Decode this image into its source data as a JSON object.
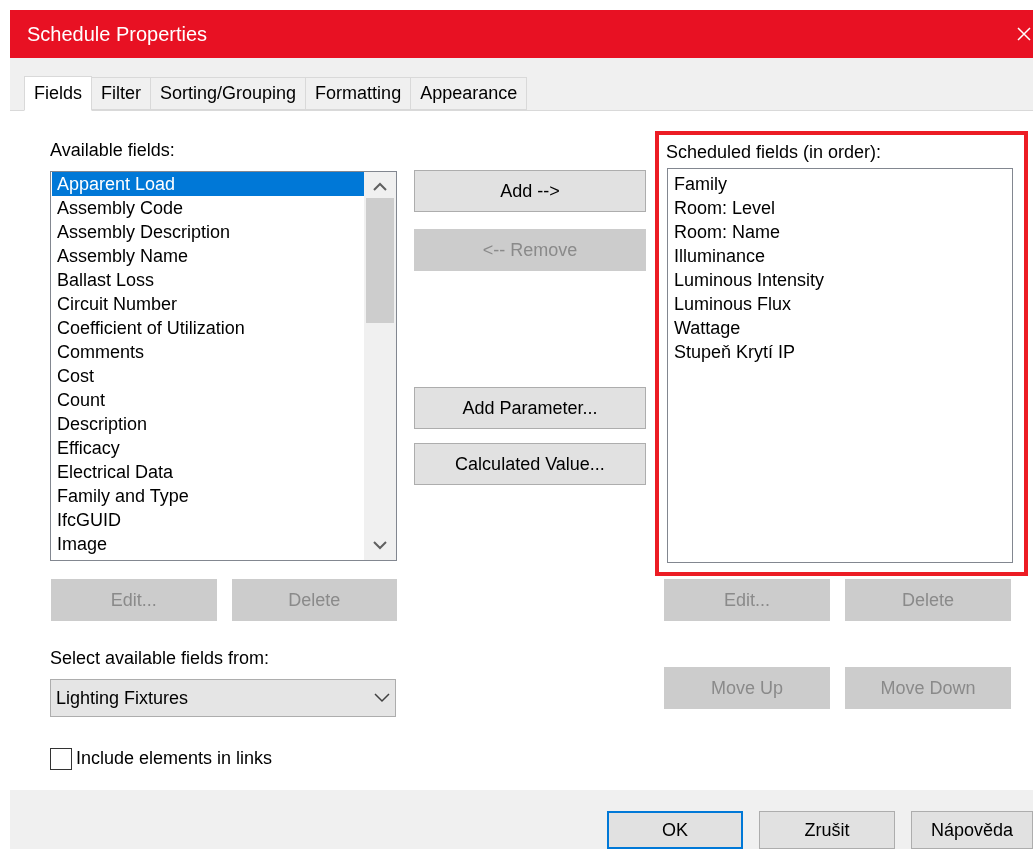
{
  "window": {
    "title": "Schedule Properties"
  },
  "tabs": [
    {
      "label": "Fields",
      "selected": true
    },
    {
      "label": "Filter",
      "selected": false
    },
    {
      "label": "Sorting/Grouping",
      "selected": false
    },
    {
      "label": "Formatting",
      "selected": false
    },
    {
      "label": "Appearance",
      "selected": false
    }
  ],
  "available_fields": {
    "label": "Available fields:",
    "items": [
      {
        "label": "Apparent Load",
        "selected": true
      },
      {
        "label": "Assembly Code",
        "selected": false
      },
      {
        "label": "Assembly Description",
        "selected": false
      },
      {
        "label": "Assembly Name",
        "selected": false
      },
      {
        "label": "Ballast Loss",
        "selected": false
      },
      {
        "label": "Circuit Number",
        "selected": false
      },
      {
        "label": "Coefficient of Utilization",
        "selected": false
      },
      {
        "label": "Comments",
        "selected": false
      },
      {
        "label": "Cost",
        "selected": false
      },
      {
        "label": "Count",
        "selected": false
      },
      {
        "label": "Description",
        "selected": false
      },
      {
        "label": "Efficacy",
        "selected": false
      },
      {
        "label": "Electrical Data",
        "selected": false
      },
      {
        "label": "Family and Type",
        "selected": false
      },
      {
        "label": "IfcGUID",
        "selected": false
      },
      {
        "label": "Image",
        "selected": false
      }
    ],
    "buttons": [
      {
        "label": "Edit...",
        "disabled": true
      },
      {
        "label": "Delete",
        "disabled": true
      }
    ]
  },
  "source": {
    "label": "Select available fields from:",
    "value": "Lighting Fixtures"
  },
  "include_links": {
    "label": "Include elements in links",
    "checked": false
  },
  "middle_buttons": [
    {
      "label": "Add -->",
      "disabled": false,
      "kind": "top"
    },
    {
      "label": "<-- Remove",
      "disabled": true,
      "kind": "top"
    },
    {
      "label": "Add Parameter...",
      "disabled": false,
      "kind": "bottom"
    },
    {
      "label": "Calculated Value...",
      "disabled": false,
      "kind": "bottom"
    }
  ],
  "scheduled_fields": {
    "label": "Scheduled fields (in order):",
    "highlighted": true,
    "items": [
      {
        "label": "Family",
        "selected": false
      },
      {
        "label": "Room: Level",
        "selected": false
      },
      {
        "label": "Room: Name",
        "selected": false
      },
      {
        "label": "Illuminance",
        "selected": false
      },
      {
        "label": "Luminous Intensity",
        "selected": false
      },
      {
        "label": "Luminous Flux",
        "selected": false
      },
      {
        "label": "Wattage",
        "selected": false
      },
      {
        "label": "Stupeň Krytí IP",
        "selected": false
      }
    ],
    "buttons": [
      {
        "label": "Edit...",
        "disabled": true
      },
      {
        "label": "Delete",
        "disabled": true
      },
      {
        "label": "Move Up",
        "disabled": true
      },
      {
        "label": "Move Down",
        "disabled": true
      }
    ]
  },
  "footer_buttons": [
    {
      "label": "OK",
      "default": true
    },
    {
      "label": "Zrušit",
      "default": false
    },
    {
      "label": "Nápověda",
      "default": false
    }
  ]
}
